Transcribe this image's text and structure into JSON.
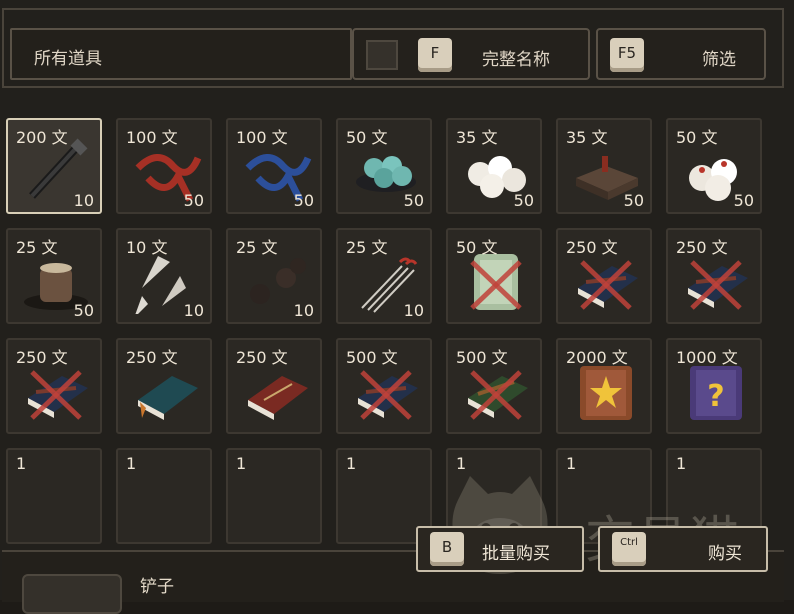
{
  "topbar": {
    "category_label": "所有道具",
    "fullname_key": "F",
    "fullname_label": "完整名称",
    "filter_key": "F5",
    "filter_label": "筛选"
  },
  "items": [
    {
      "price": "200 文",
      "count": "10",
      "icon": "shovel-icon",
      "selected": true
    },
    {
      "price": "100 文",
      "count": "50",
      "icon": "red-string-icon"
    },
    {
      "price": "100 文",
      "count": "50",
      "icon": "blue-string-icon"
    },
    {
      "price": "50 文",
      "count": "50",
      "icon": "jade-stones-icon"
    },
    {
      "price": "35 文",
      "count": "50",
      "icon": "white-buns-icon"
    },
    {
      "price": "35 文",
      "count": "50",
      "icon": "tofu-block-icon"
    },
    {
      "price": "50 文",
      "count": "50",
      "icon": "red-dot-buns-icon"
    },
    {
      "price": "25 文",
      "count": "50",
      "icon": "clay-pot-icon"
    },
    {
      "price": "10 文",
      "count": "10",
      "icon": "throwing-darts-icon"
    },
    {
      "price": "25 文",
      "count": "10",
      "icon": "iron-balls-icon"
    },
    {
      "price": "25 文",
      "count": "10",
      "icon": "needles-icon"
    },
    {
      "price": "50 文",
      "count": "",
      "icon": "locked-scroll-icon",
      "locked": true
    },
    {
      "price": "250 文",
      "count": "",
      "icon": "locked-book-icon",
      "locked": true
    },
    {
      "price": "250 文",
      "count": "",
      "icon": "locked-book-icon",
      "locked": true
    },
    {
      "price": "250 文",
      "count": "",
      "icon": "locked-book-icon",
      "locked": true
    },
    {
      "price": "250 文",
      "count": "",
      "icon": "teal-book-icon"
    },
    {
      "price": "250 文",
      "count": "",
      "icon": "red-book-icon"
    },
    {
      "price": "500 文",
      "count": "",
      "icon": "locked-book-icon",
      "locked": true
    },
    {
      "price": "500 文",
      "count": "",
      "icon": "locked-green-book-icon",
      "locked": true
    },
    {
      "price": "2000 文",
      "count": "",
      "icon": "star-book-icon"
    },
    {
      "price": "1000 文",
      "count": "",
      "icon": "mystery-book-icon"
    },
    {
      "price": "1",
      "count": "",
      "icon": ""
    },
    {
      "price": "1",
      "count": "",
      "icon": ""
    },
    {
      "price": "1",
      "count": "",
      "icon": ""
    },
    {
      "price": "1",
      "count": "",
      "icon": ""
    },
    {
      "price": "1",
      "count": "",
      "icon": ""
    },
    {
      "price": "1",
      "count": "",
      "icon": ""
    },
    {
      "price": "1",
      "count": "",
      "icon": ""
    }
  ],
  "actions": {
    "bulk_key": "B",
    "bulk_label": "批量购买",
    "buy_key": "Ctrl",
    "buy_label": "购买"
  },
  "detail": {
    "item_name": "铲子"
  },
  "watermark": {
    "text": "交易猫"
  },
  "colors": {
    "background": "#22201c",
    "cell": "#2b2823",
    "selected_border": "#d8cfb7",
    "locked_x": "#c0423a"
  }
}
